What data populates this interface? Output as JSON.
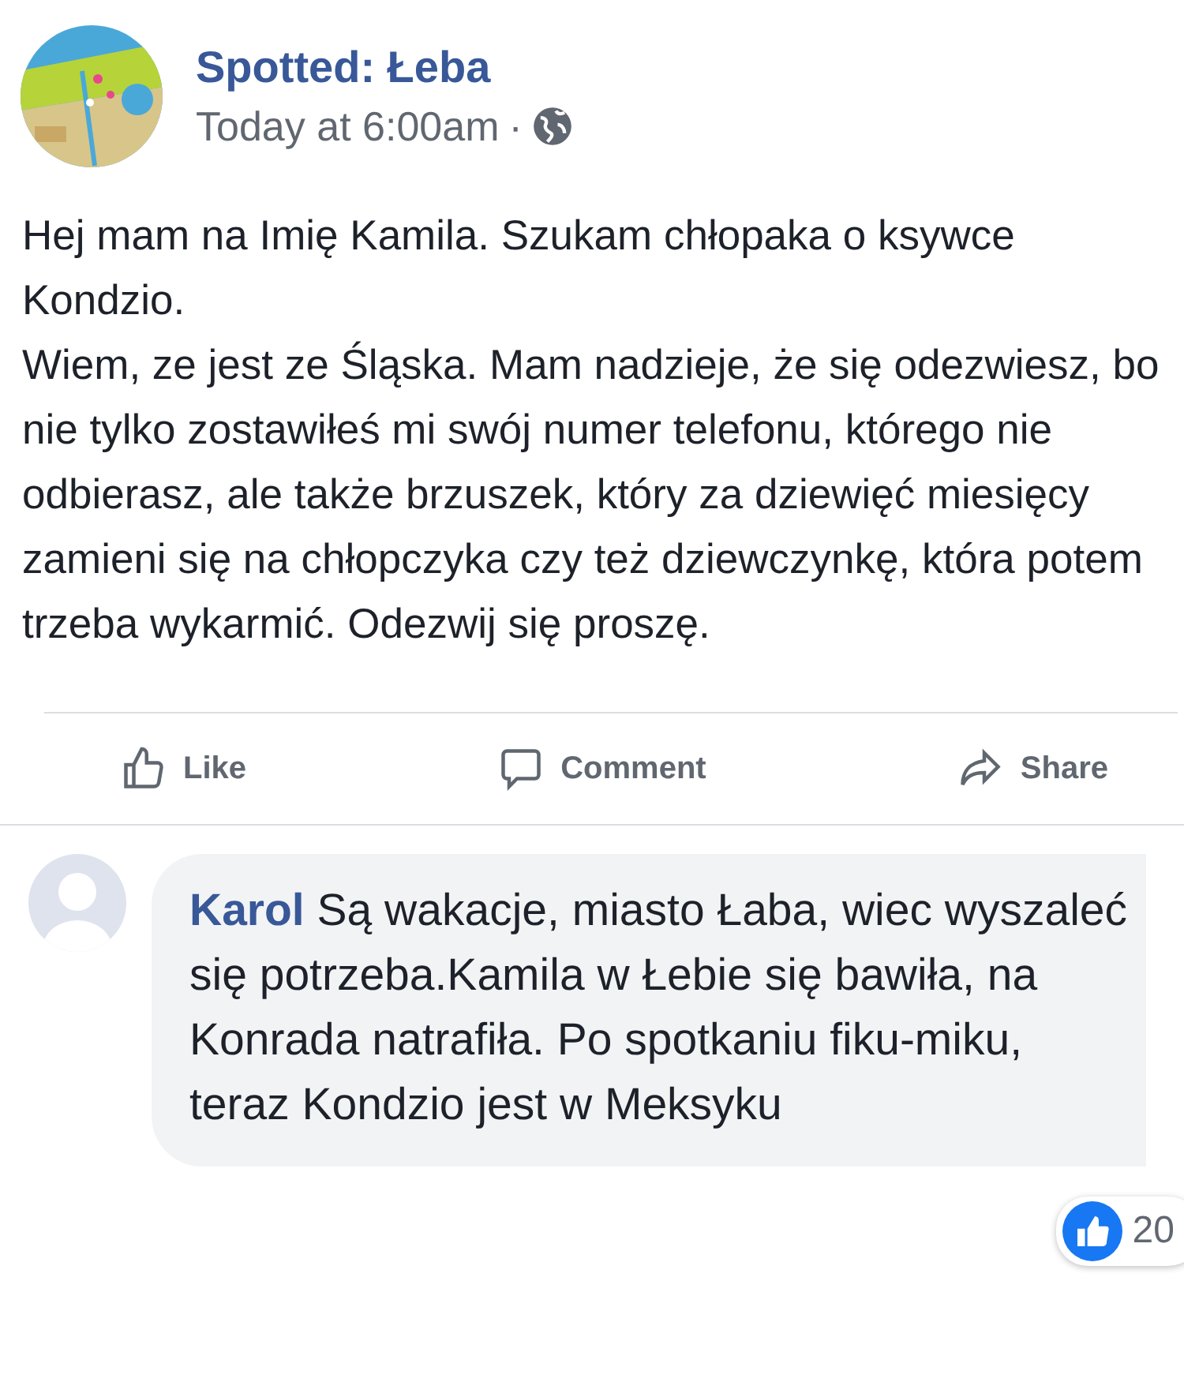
{
  "post": {
    "author": "Spotted: Łeba",
    "time": "Today at 6:00am",
    "separator": "·",
    "paragraphs": [
      "Hej mam na Imię Kamila. Szukam chłopaka o ksywce Kondzio.",
      "Wiem, ze jest ze Śląska. Mam nadzieje, że się odezwiesz, bo nie tylko zostawiłeś mi swój numer telefonu, którego nie odbierasz, ale także brzuszek, który za dziewięć miesięcy zamieni się na chłopczyka czy też dziewczynkę, która potem trzeba wykarmić. Odezwij się proszę."
    ]
  },
  "actions": [
    {
      "kind": "like",
      "label": "Like"
    },
    {
      "kind": "comment",
      "label": "Comment"
    },
    {
      "kind": "share",
      "label": "Share"
    }
  ],
  "comment": {
    "author": "Karol",
    "text": "Są wakacje, miasto Łaba, wiec wyszaleć się potrzeba.Kamila w Łebie się bawiła, na Konrada natrafiła. Po spotkaniu fiku-miku, teraz Kondzio jest w Meksyku",
    "reactions": "20"
  }
}
